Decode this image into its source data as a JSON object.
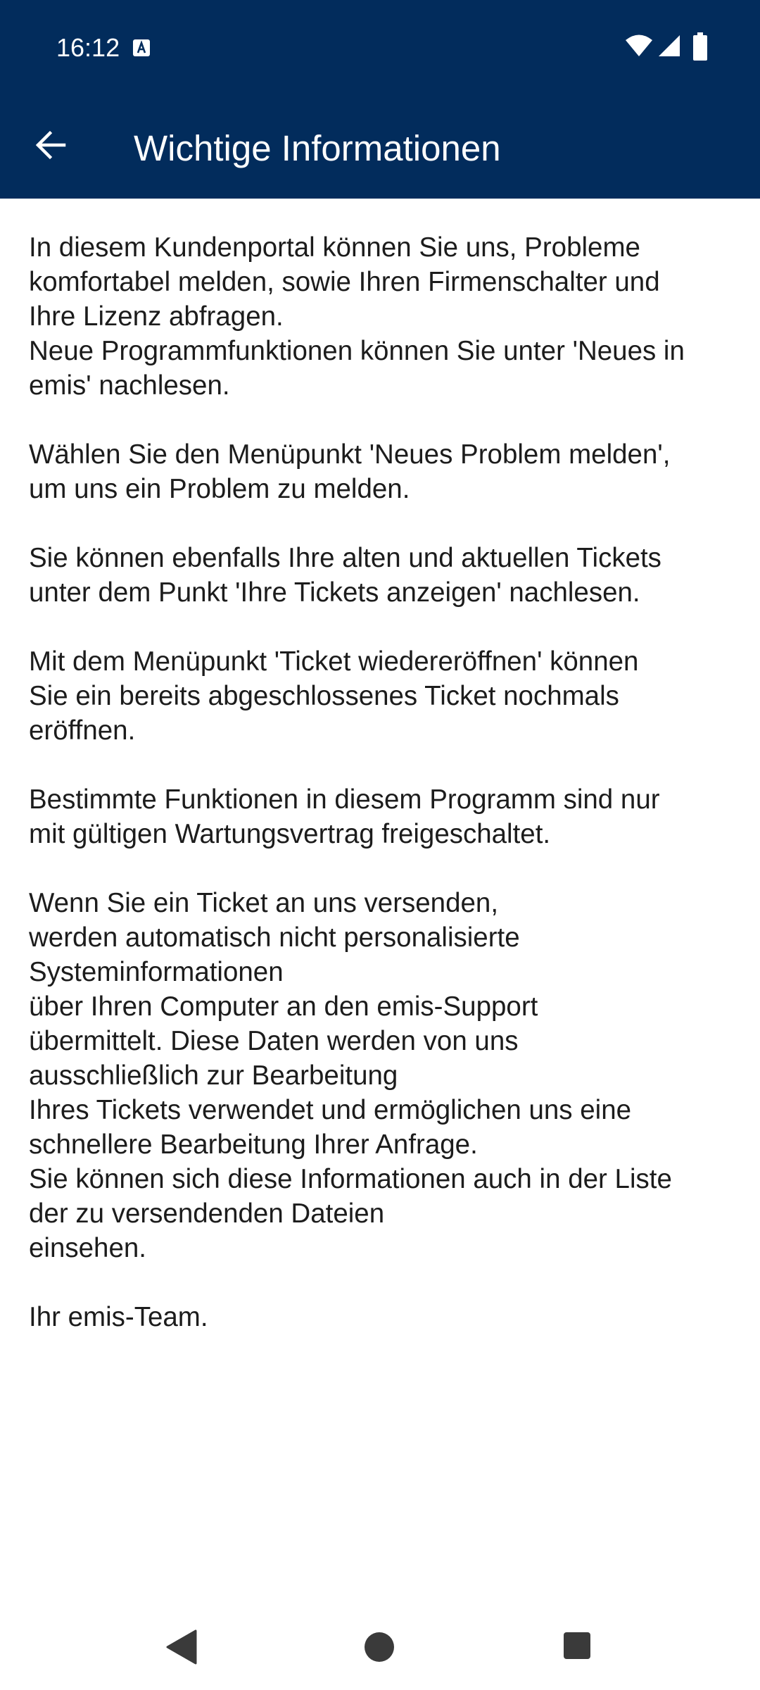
{
  "status_bar": {
    "time": "16:12",
    "icons": [
      "keyboard-a-icon",
      "wifi-icon",
      "signal-icon",
      "battery-icon"
    ]
  },
  "app_bar": {
    "title": "Wichtige Informationen",
    "back_icon": "arrow-back-icon",
    "background_color": "#022c5c",
    "text_color": "#ffffff"
  },
  "content": {
    "paragraphs": [
      "In diesem Kundenportal können Sie uns, Probleme\nkomfortabel melden, sowie Ihren Firmenschalter und\nIhre Lizenz abfragen.\nNeue Programmfunktionen können Sie unter 'Neues in\nemis' nachlesen.",
      "Wählen Sie den Menüpunkt 'Neues Problem melden',\num uns ein Problem zu melden.",
      "Sie können ebenfalls Ihre alten und aktuellen Tickets\nunter dem Punkt 'Ihre Tickets anzeigen' nachlesen.",
      "Mit dem Menüpunkt 'Ticket wiedereröffnen' können\nSie ein bereits abgeschlossenes Ticket nochmals\neröffnen.",
      "Bestimmte Funktionen in diesem Programm sind nur\nmit gültigen Wartungsvertrag freigeschaltet.",
      "Wenn Sie ein Ticket an uns versenden,\nwerden automatisch nicht personalisierte\nSysteminformationen\nüber Ihren Computer an den emis-Support\nübermittelt. Diese Daten werden von uns\nausschließlich zur Bearbeitung\nIhres Tickets verwendet und ermöglichen uns eine\nschnellere Bearbeitung Ihrer Anfrage.\nSie können sich diese Informationen auch in der Liste\nder zu versendenden Dateien\neinsehen.",
      "Ihr emis-Team."
    ]
  },
  "nav_bar": {
    "icons": [
      "nav-back-icon",
      "nav-home-icon",
      "nav-recents-icon"
    ]
  }
}
